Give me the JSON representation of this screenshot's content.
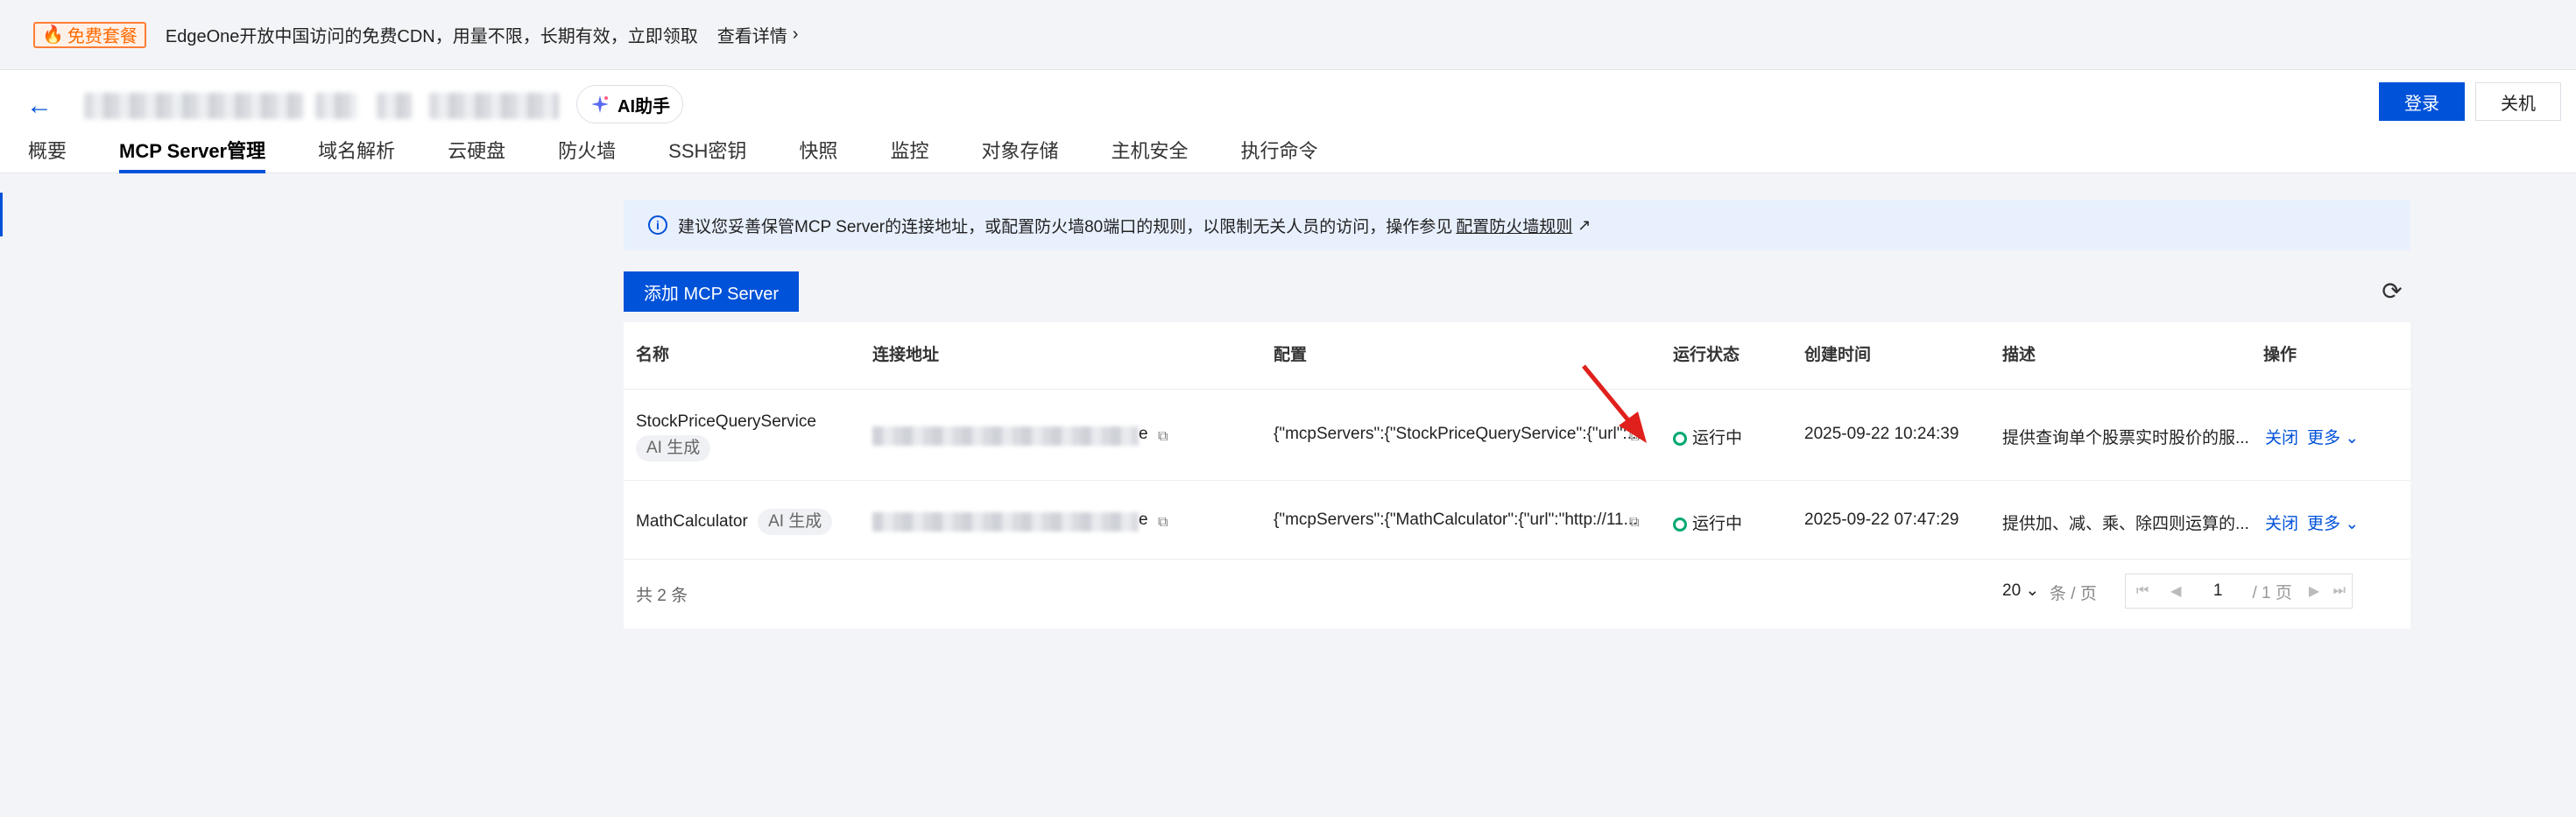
{
  "promo": {
    "badge": "免费套餐",
    "text": "EdgeOne开放中国访问的免费CDN，用量不限，长期有效，立即领取",
    "link": "查看详情"
  },
  "header": {
    "ai_assistant": "AI助手",
    "login": "登录",
    "shutdown": "关机",
    "tabs": [
      "概要",
      "MCP Server管理",
      "域名解析",
      "云硬盘",
      "防火墙",
      "SSH密钥",
      "快照",
      "监控",
      "对象存储",
      "主机安全",
      "执行命令"
    ]
  },
  "notice": {
    "text": "建议您妥善保管MCP Server的连接地址，或配置防火墙80端口的规则，以限制无关人员的访问，操作参见",
    "link": "配置防火墙规则"
  },
  "toolbar": {
    "add_button": "添加 MCP Server"
  },
  "table": {
    "headers": [
      "名称",
      "连接地址",
      "配置",
      "运行状态",
      "创建时间",
      "描述",
      "操作"
    ],
    "rows": [
      {
        "name": "StockPriceQueryService",
        "tag": "AI 生成",
        "url_suffix": "e",
        "config": "{\"mcpServers\":{\"StockPriceQueryService\":{\"url\":...",
        "status": "运行中",
        "created": "2025-09-22 10:24:39",
        "description": "提供查询单个股票实时股价的服...",
        "action_close": "关闭",
        "action_more": "更多"
      },
      {
        "name": "MathCalculator",
        "tag": "AI 生成",
        "url_suffix": "e",
        "config": "{\"mcpServers\":{\"MathCalculator\":{\"url\":\"http://11...",
        "status": "运行中",
        "created": "2025-09-22 07:47:29",
        "description": "提供加、减、乘、除四则运算的...",
        "action_close": "关闭",
        "action_more": "更多"
      }
    ],
    "total": "共 2 条",
    "page_size": "20",
    "page_size_unit": "条 / 页",
    "page": "1",
    "page_total": "/ 1 页"
  },
  "colors": {
    "primary": "#0052d9",
    "success": "#00a870",
    "promo": "#ff6a00",
    "annotation": "#e0201c"
  }
}
